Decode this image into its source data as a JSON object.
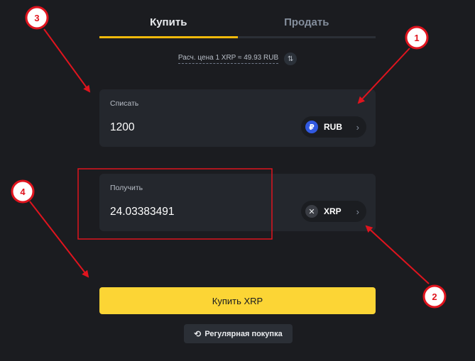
{
  "tabs": {
    "buy_label": "Купить",
    "sell_label": "Продать"
  },
  "rate": {
    "text": "Расч. цена 1 XRP ≈ 49.93 RUB",
    "swap_icon": "swap-vertical-icon"
  },
  "spend": {
    "label": "Списать",
    "amount": "1200",
    "currency": "RUB",
    "coin_glyph": "₽",
    "chevron": "›"
  },
  "receive": {
    "label": "Получить",
    "amount": "24.03383491",
    "currency": "XRP",
    "coin_glyph": "✕",
    "chevron": "›"
  },
  "actions": {
    "buy_button": "Купить XRP",
    "recurring_button": "Регулярная покупка",
    "recurring_icon": "history-clock-icon"
  },
  "annotations": {
    "badges": [
      "1",
      "2",
      "3",
      "4"
    ],
    "color": "#e0141e"
  },
  "colors": {
    "accent": "#fcd535",
    "tab_underline": "#f0b90b",
    "background": "#1b1c20",
    "panel": "#24272d",
    "rub_coin": "#3159e0",
    "annotation_red": "#e0141e"
  }
}
